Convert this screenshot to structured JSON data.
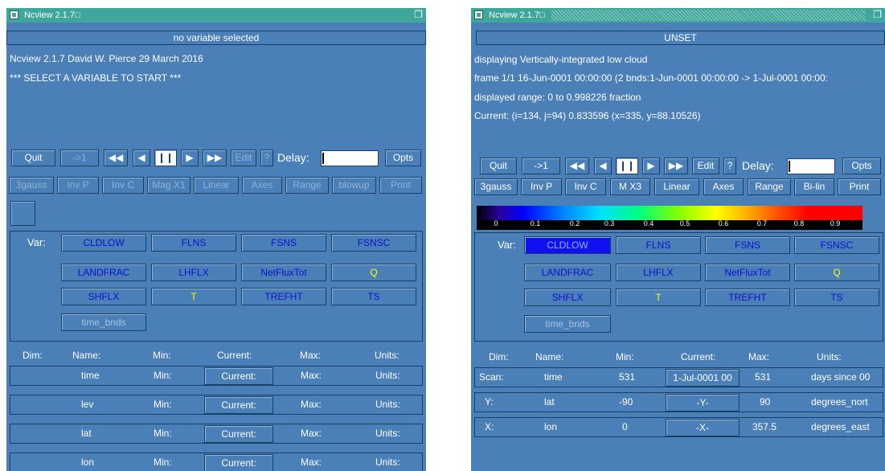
{
  "win_a": {
    "title": "Ncview 2.1.7□",
    "status": "no variable selected",
    "info": [
      "Ncview 2.1.7 David W. Pierce  29 March 2016",
      "*** SELECT A VARIABLE TO START ***"
    ],
    "controls": {
      "quit": "Quit",
      "rewind": "->1",
      "back_fast": "◀◀",
      "back": "◀",
      "pause": "❙❙",
      "forward": "▶",
      "forward_fast": "▶▶",
      "edit": "Edit",
      "help": "?",
      "delay_label": "Delay:",
      "opts": "Opts"
    },
    "options": [
      "3gauss",
      "Inv P",
      "Inv C",
      "Mag X1",
      "Linear",
      "Axes",
      "Range",
      "blowup",
      "Print"
    ],
    "var_label": "Var:",
    "vars": [
      "CLDLOW",
      "FLNS",
      "FSNS",
      "FSNSC",
      "LANDFRAC",
      "LHFLX",
      "NetFluxTot",
      "Q",
      "SHFLX",
      "T",
      "TREFHT",
      "TS",
      "time_bnds"
    ],
    "dim_header": {
      "dim": "Dim:",
      "name": "Name:",
      "min": "Min:",
      "current": "Current:",
      "max": "Max:",
      "units": "Units:"
    },
    "dims": [
      {
        "dim": "",
        "name": "time",
        "min": "Min:",
        "current": "Current:",
        "max": "Max:",
        "units": "Units:"
      },
      {
        "dim": "",
        "name": "lev",
        "min": "Min:",
        "current": "Current:",
        "max": "Max:",
        "units": "Units:"
      },
      {
        "dim": "",
        "name": "lat",
        "min": "Min:",
        "current": "Current:",
        "max": "Max:",
        "units": "Units:"
      },
      {
        "dim": "",
        "name": "lon",
        "min": "Min:",
        "current": "Current:",
        "max": "Max:",
        "units": "Units:"
      }
    ]
  },
  "win_b": {
    "title": "Ncview 2.1.7□",
    "status": "UNSET",
    "info": [
      "displaying Vertically-integrated low cloud",
      "frame 1/1 16-Jun-0001 00:00:00 (2 bnds:1-Jun-0001 00:00:00 -> 1-Jul-0001 00:00:",
      "displayed range: 0 to 0.998226 fraction",
      "Current: (i=134, j=94) 0.833596 (x=335, y=88.10526)"
    ],
    "controls": {
      "quit": "Quit",
      "rewind": "->1",
      "back_fast": "◀◀",
      "back": "◀",
      "pause": "❙❙",
      "forward": "▶",
      "forward_fast": "▶▶",
      "edit": "Edit",
      "help": "?",
      "delay_label": "Delay:",
      "opts": "Opts"
    },
    "options": [
      "3gauss",
      "Inv P",
      "Inv C",
      "M X3",
      "Linear",
      "Axes",
      "Range",
      "Bi-lin",
      "Print"
    ],
    "colorbar_ticks": [
      "0",
      "0.1",
      "0.2",
      "0.3",
      "0.4",
      "0.5",
      "0.6",
      "0.7",
      "0.8",
      "0.9"
    ],
    "var_label": "Var:",
    "vars": [
      "CLDLOW",
      "FLNS",
      "FSNS",
      "FSNSC",
      "LANDFRAC",
      "LHFLX",
      "NetFluxTot",
      "Q",
      "SHFLX",
      "T",
      "TREFHT",
      "TS",
      "time_bnds"
    ],
    "dim_header": {
      "dim": "Dim:",
      "name": "Name:",
      "min": "Min:",
      "current": "Current:",
      "max": "Max:",
      "units": "Units:"
    },
    "dims": [
      {
        "dim": "Scan:",
        "name": "time",
        "min": "531",
        "current": "1-Jul-0001 00",
        "max": "531",
        "units": "days since 00"
      },
      {
        "dim": "Y:",
        "name": "lat",
        "min": "-90",
        "current": "-Y-",
        "max": "90",
        "units": "degrees_nort"
      },
      {
        "dim": "X:",
        "name": "lon",
        "min": "0",
        "current": "-X-",
        "max": "357.5",
        "units": "degrees_east"
      }
    ]
  },
  "colors": {
    "window_bg": "#4a7fb7",
    "titlebar": "#3fa69b",
    "var_text": "#1010d0",
    "var_yellow": "#ffff00",
    "selected_var_bg": "#1010f0"
  }
}
